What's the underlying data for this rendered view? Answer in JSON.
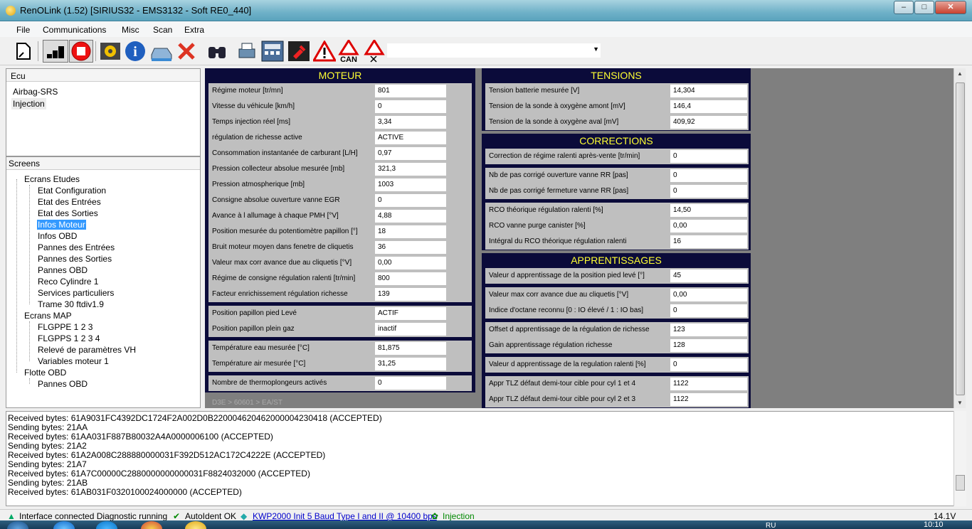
{
  "window": {
    "title": "RenOLink (1.52) [SIRIUS32 - EMS3132 - Soft RE0_440]",
    "minimize": "–",
    "maximize": "□",
    "close": "✕"
  },
  "menu": [
    "File",
    "Communications",
    "Misc",
    "Scan",
    "Extra"
  ],
  "toolbar": {
    "icons": [
      "open-file-icon",
      "signal-bars-icon",
      "stop-icon",
      "settings-gear-icon",
      "info-icon",
      "car-icon",
      "cancel-icon",
      "binoculars-icon",
      "printer-icon",
      "calculator-icon",
      "pin-icon",
      "warning-icon",
      "can-warning-icon",
      "warning-cross-icon"
    ],
    "can_label": "CAN",
    "combo_value": ""
  },
  "ecu": {
    "header": "Ecu",
    "items": [
      "Airbag-SRS",
      "Injection"
    ],
    "selected": "Injection"
  },
  "screens": {
    "header": "Screens",
    "groups": [
      {
        "label": "Ecrans Etudes",
        "items": [
          "Etat Configuration",
          "Etat des Entrées",
          "Etat des Sorties",
          "Infos Moteur",
          "Infos OBD",
          "Pannes des Entrées",
          "Pannes des Sorties",
          "Pannes OBD",
          "Reco Cylindre 1",
          "Services particuliers",
          "Trame 30 ftdiv1.9"
        ]
      },
      {
        "label": "Ecrans MAP",
        "items": [
          "FLGPPE 1 2 3",
          "FLGPPS 1 2 3 4",
          "Relevé de paramètres VH",
          "Variables moteur 1"
        ]
      },
      {
        "label": "Flotte OBD",
        "items": [
          "Pannes OBD"
        ]
      }
    ],
    "selected": "Infos Moteur"
  },
  "moteur": {
    "title": "MOTEUR",
    "groups": [
      [
        {
          "label": "Régime moteur [tr/mn]",
          "value": "801"
        },
        {
          "label": "Vitesse du véhicule [km/h]",
          "value": "0"
        },
        {
          "label": "Temps injection réel [ms]",
          "value": "3,34"
        },
        {
          "label": "régulation de richesse active",
          "value": "ACTIVE"
        },
        {
          "label": "Consommation instantanée de carburant [L/H]",
          "value": "0,97"
        },
        {
          "label": "Pression collecteur absolue mesurée [mb]",
          "value": "321,3"
        },
        {
          "label": "Pression atmospherique [mb]",
          "value": "1003"
        },
        {
          "label": "Consigne absolue ouverture vanne EGR",
          "value": "0"
        },
        {
          "label": "Avance à l allumage à chaque PMH [°V]",
          "value": "4,88"
        },
        {
          "label": "Position mesurée du potentiomètre papillon [°]",
          "value": "18"
        },
        {
          "label": "Bruit moteur moyen dans fenetre de cliquetis",
          "value": "36"
        },
        {
          "label": "Valeur max corr avance due au cliquetis [°V]",
          "value": "0,00"
        },
        {
          "label": "Régime de consigne régulation ralenti [tr/min]",
          "value": "800"
        },
        {
          "label": "Facteur enrichissement régulation richesse",
          "value": "139"
        }
      ],
      [
        {
          "label": "Position papillon pied Levé",
          "value": "ACTIF"
        },
        {
          "label": "Position papillon plein gaz",
          "value": "inactif"
        }
      ],
      [
        {
          "label": "Température eau mesurée [°C]",
          "value": "81,875"
        },
        {
          "label": "Température air mesurée [°C]",
          "value": "31,25"
        }
      ],
      [
        {
          "label": "Nombre de thermoplongeurs activés",
          "value": "0"
        }
      ]
    ],
    "path": "D3E > 60601 > EA/ST"
  },
  "tensions": {
    "title": "TENSIONS",
    "rows": [
      {
        "label": "Tension batterie mesurée [V]",
        "value": "14,304"
      },
      {
        "label": "Tension de la sonde à oxygène amont [mV]",
        "value": "146,4"
      },
      {
        "label": "Tension de la sonde à oxygène aval [mV]",
        "value": "409,92"
      }
    ]
  },
  "corrections": {
    "title": "CORRECTIONS",
    "groups": [
      [
        {
          "label": "Correction de régime ralenti après-vente [tr/min]",
          "value": "0"
        }
      ],
      [
        {
          "label": "Nb de pas corrigé ouverture vanne RR [pas]",
          "value": "0"
        },
        {
          "label": "Nb de pas corrigé fermeture vanne RR [pas]",
          "value": "0"
        }
      ],
      [
        {
          "label": "RCO théorique régulation ralenti [%]",
          "value": "14,50"
        },
        {
          "label": "RCO vanne purge canister [%]",
          "value": "0,00"
        },
        {
          "label": "Intégral du RCO théorique régulation ralenti",
          "value": "16"
        }
      ]
    ]
  },
  "apprentissages": {
    "title": "APPRENTISSAGES",
    "groups": [
      [
        {
          "label": "Valeur d apprentissage de la position pied levé [°]",
          "value": "45"
        }
      ],
      [
        {
          "label": "Valeur max corr avance due au cliquetis [°V]",
          "value": "0,00"
        },
        {
          "label": "Indice d'octane reconnu [0 : IO élevé / 1 : IO bas]",
          "value": "0"
        }
      ],
      [
        {
          "label": "Offset d apprentissage de la régulation de richesse",
          "value": "123"
        },
        {
          "label": "Gain apprentissage régulation richesse",
          "value": "128"
        }
      ],
      [
        {
          "label": "Valeur d apprentissage de la regulation ralenti [%]",
          "value": "0"
        }
      ],
      [
        {
          "label": "Appr TLZ défaut demi-tour cible pour cyl 1 et 4",
          "value": "1122"
        },
        {
          "label": "Appr TLZ défaut demi-tour cible pour cyl 2 et 3",
          "value": "1122"
        }
      ]
    ]
  },
  "log": [
    "Received bytes: 61A9031FC4392DC1724F2A002D0B220004620462000004230418 (ACCEPTED)",
    "Sending bytes: 21AA",
    "Received bytes: 61AA031F887B80032A4A0000006100 (ACCEPTED)",
    "Sending bytes: 21A2",
    "Received bytes: 61A2A008C288880000031F392D512AC172C4222E (ACCEPTED)",
    "Sending bytes: 21A7",
    "Received bytes: 61A7C00000C2880000000000031F8824032000 (ACCEPTED)",
    "Sending bytes: 21AB",
    "Received bytes: 61AB031F0320100024000000 (ACCEPTED)"
  ],
  "status": {
    "connection": "Interface connected Diagnostic running",
    "autoident": "AutoIdent OK",
    "protocol": "KWP2000 Init 5 Baud Type I and II @ 10400 bps",
    "ecu": "Injection",
    "voltage": "14.1V"
  },
  "taskbar": {
    "time": "10:10",
    "lang": "RU"
  },
  "colors": {
    "panel_bg": "#0b0b3a",
    "panel_title": "#ffff33",
    "row_bg": "#bfbfbf",
    "main_bg": "#7f7f7f",
    "selection": "#3399ff",
    "status_link": "#0000cc",
    "status_green": "#008800"
  }
}
